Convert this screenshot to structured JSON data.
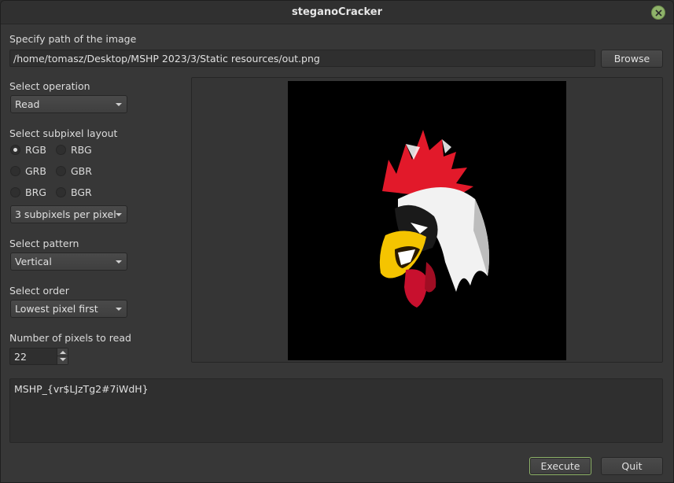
{
  "window": {
    "title": "steganoCracker"
  },
  "path": {
    "label": "Specify path of the image",
    "value": "/home/tomasz/Desktop/MSHP 2023/3/Static resources/out.png",
    "browse_label": "Browse"
  },
  "operation": {
    "label": "Select operation",
    "selected": "Read"
  },
  "subpixel": {
    "label": "Select subpixel layout",
    "options": [
      "RGB",
      "RBG",
      "GRB",
      "GBR",
      "BRG",
      "BGR"
    ],
    "selected": "RGB",
    "per_pixel": "3 subpixels per pixel"
  },
  "pattern": {
    "label": "Select pattern",
    "selected": "Vertical"
  },
  "order": {
    "label": "Select order",
    "selected": "Lowest pixel first"
  },
  "pixels": {
    "label": "Number of pixels to read",
    "value": "22"
  },
  "output": {
    "text": "MSHP_{vr$LJzTg2#7iWdH}"
  },
  "actions": {
    "execute_label": "Execute",
    "quit_label": "Quit"
  },
  "colors": {
    "accent": "#8fb36a",
    "background": "#373737"
  }
}
